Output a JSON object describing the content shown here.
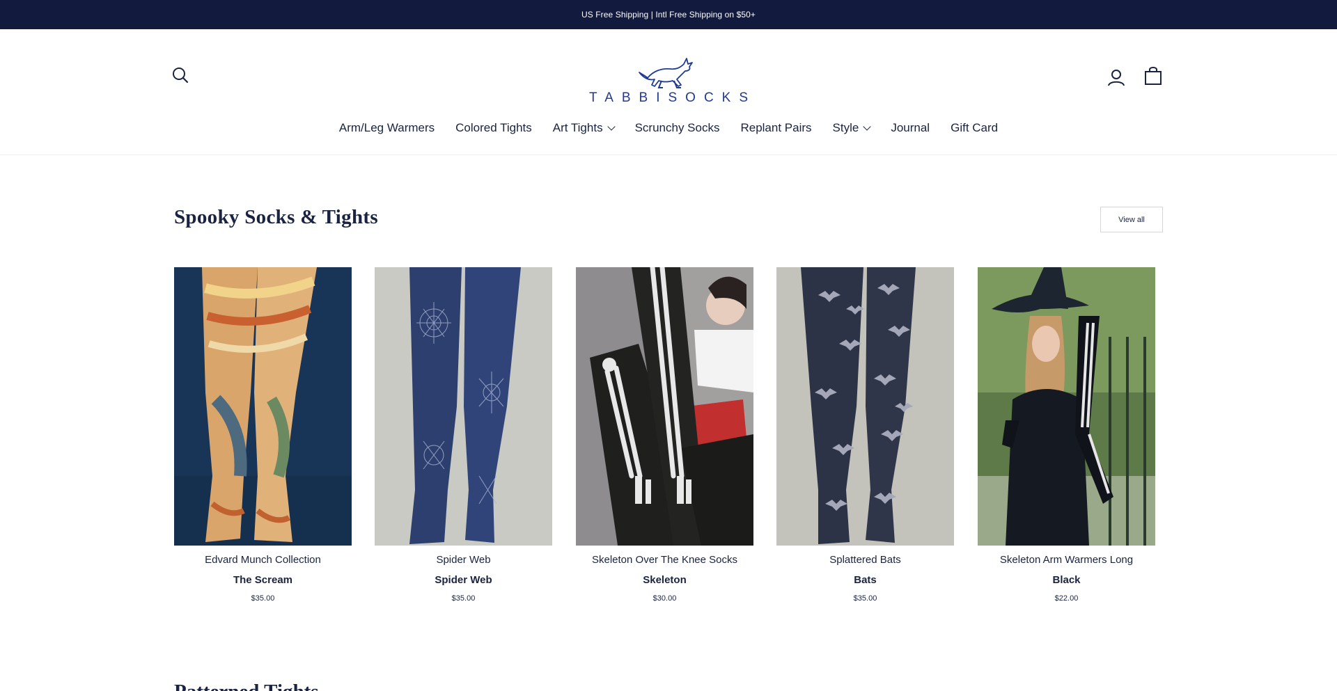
{
  "announcement": "US Free Shipping | Intl Free Shipping on $50+",
  "brand": {
    "logo_text": "TABBISOCKS",
    "accent_color": "#1f3a93",
    "bar_color": "#121a3e"
  },
  "header_icons": [
    "search-icon",
    "account-icon",
    "cart-icon"
  ],
  "nav": [
    {
      "label": "Arm/Leg Warmers",
      "dropdown": false
    },
    {
      "label": "Colored Tights",
      "dropdown": false
    },
    {
      "label": "Art Tights",
      "dropdown": true
    },
    {
      "label": "Scrunchy Socks",
      "dropdown": false
    },
    {
      "label": "Replant Pairs",
      "dropdown": false
    },
    {
      "label": "Style",
      "dropdown": true
    },
    {
      "label": "Journal",
      "dropdown": false
    },
    {
      "label": "Gift Card",
      "dropdown": false
    }
  ],
  "section": {
    "title": "Spooky Socks & Tights",
    "view_all": "View all"
  },
  "products": [
    {
      "name": "Edvard Munch Collection",
      "variant": "The Scream",
      "price": "$35.00"
    },
    {
      "name": "Spider Web",
      "variant": "Spider Web",
      "price": "$35.00"
    },
    {
      "name": "Skeleton Over The Knee Socks",
      "variant": "Skeleton",
      "price": "$30.00"
    },
    {
      "name": "Splattered Bats",
      "variant": "Bats",
      "price": "$35.00"
    },
    {
      "name": "Skeleton Arm Warmers Long",
      "variant": "Black",
      "price": "$22.00"
    }
  ],
  "next_section": {
    "title": "Patterned Tights"
  }
}
